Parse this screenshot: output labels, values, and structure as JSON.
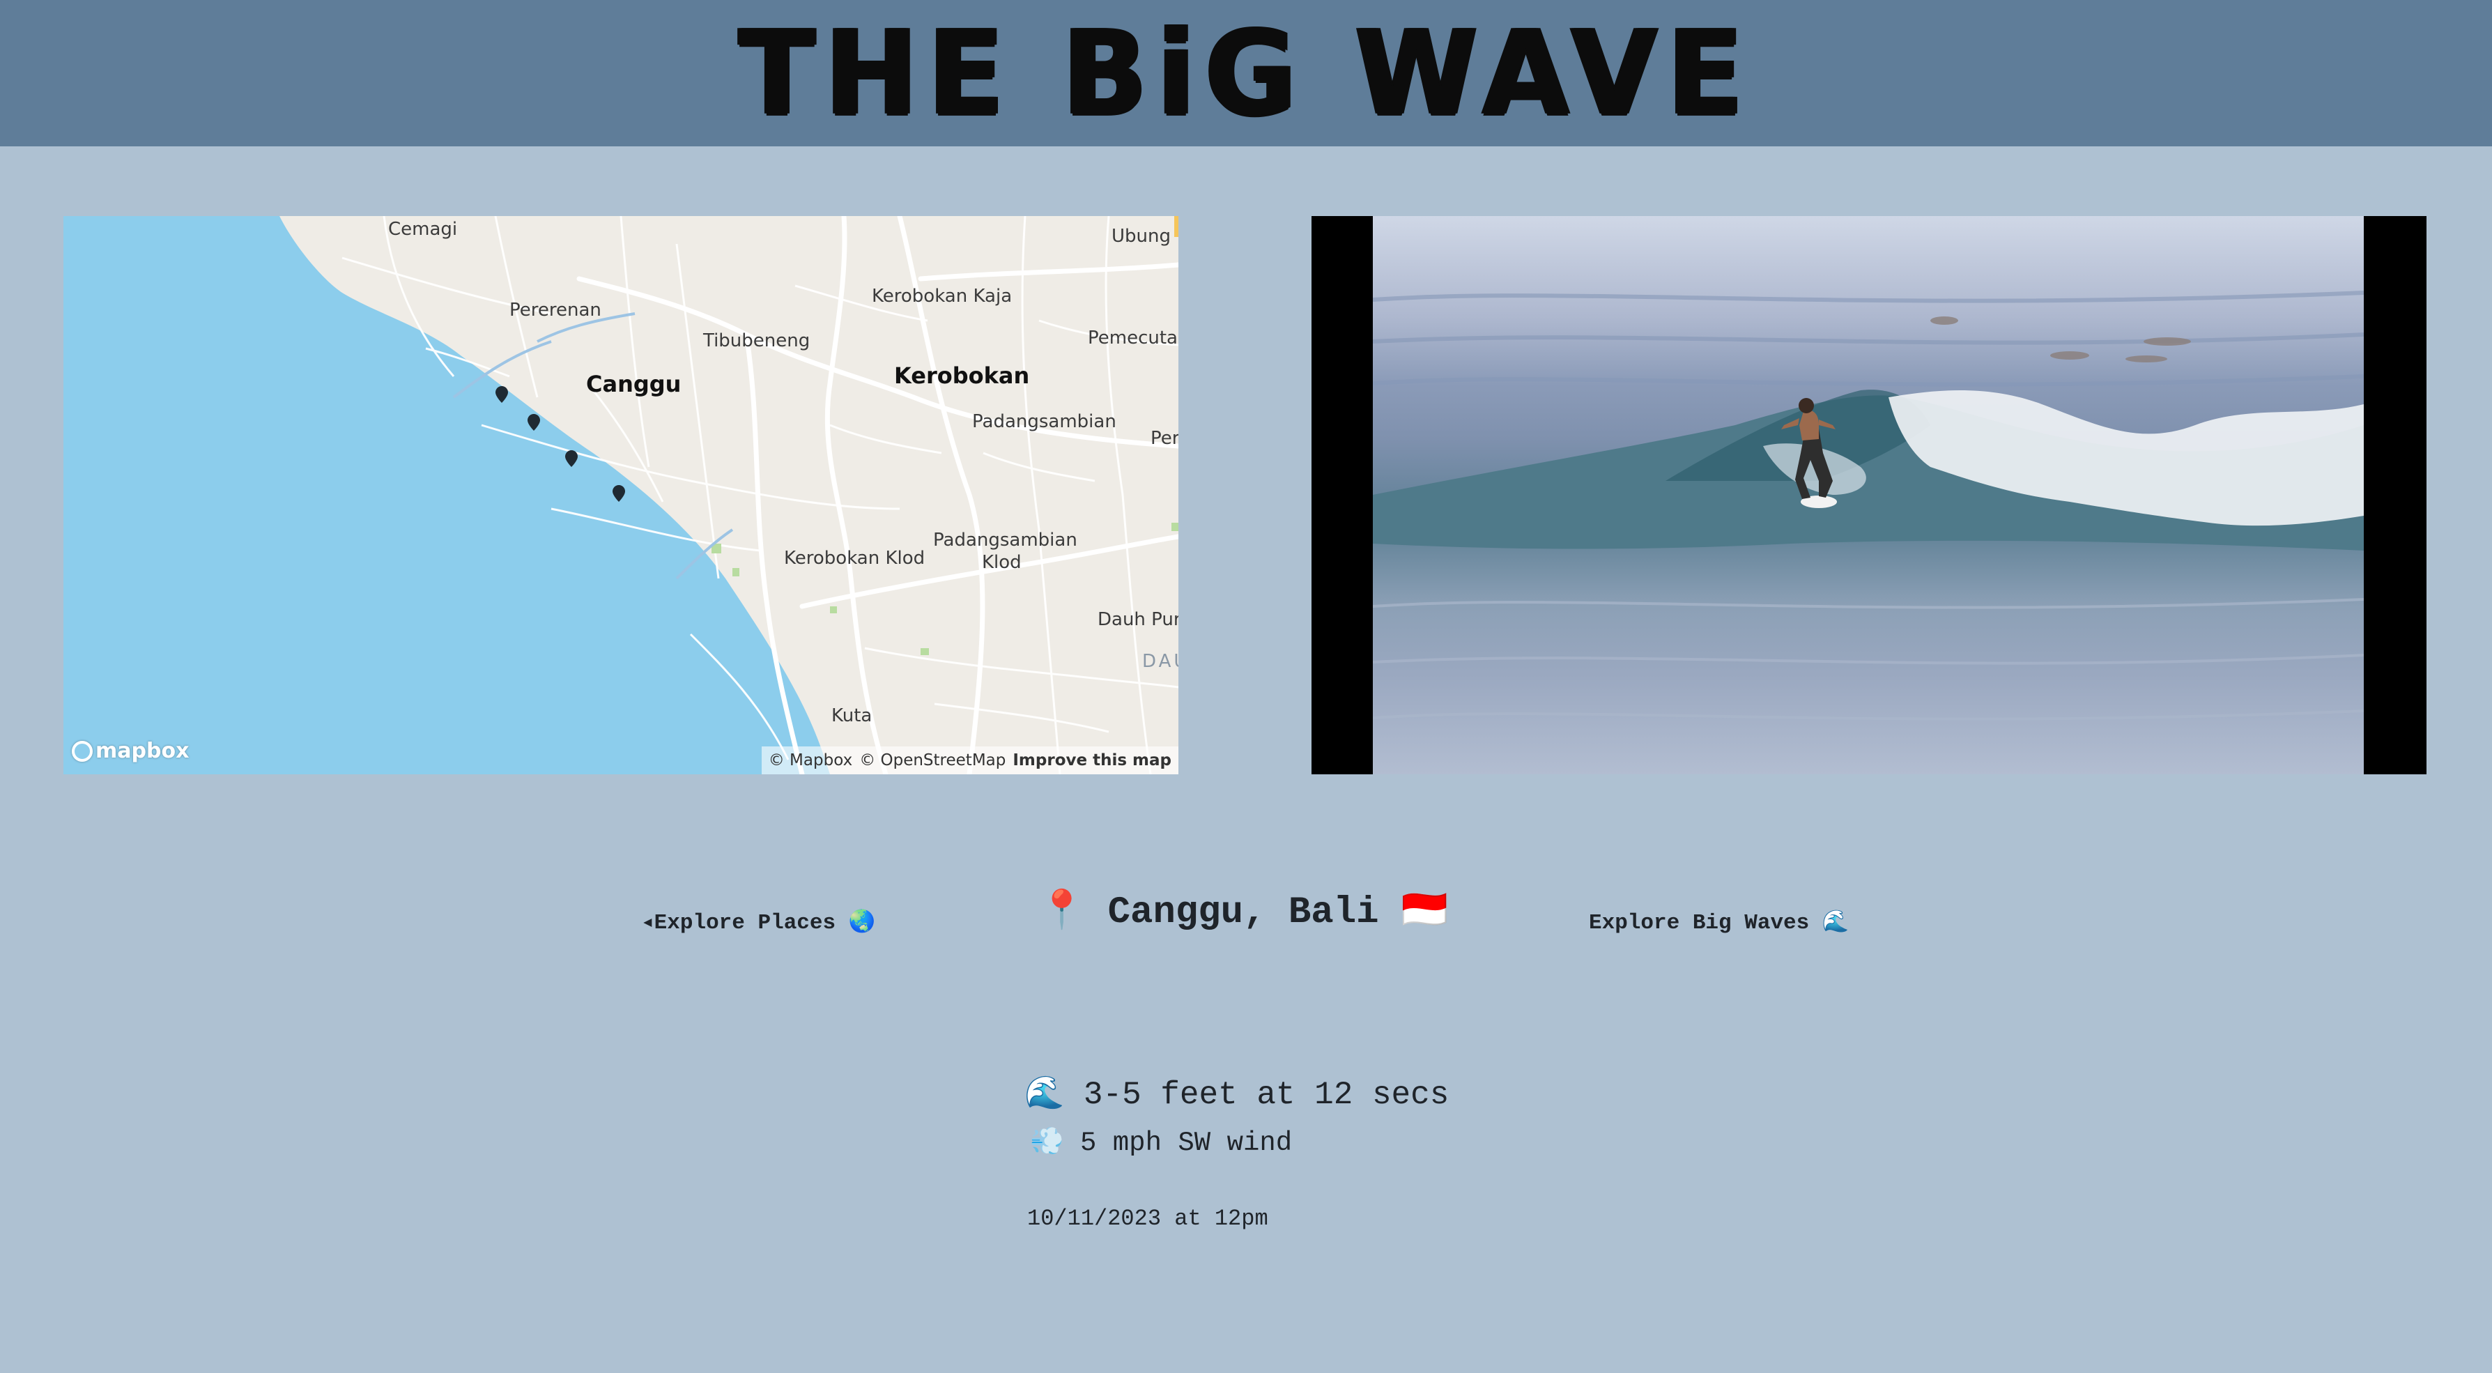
{
  "header": {
    "title": "THE BiG WAVE"
  },
  "map": {
    "labels": {
      "cemagi": "Cemagi",
      "ubung": "Ubung",
      "pererenan": "Pererenan",
      "kerobokan_kaja": "Kerobokan Kaja",
      "tibubeneng": "Tibubeneng",
      "pemecutan": "Pemecutar",
      "canggu": "Canggu",
      "kerobokan": "Kerobokan",
      "padangsambian": "Padangsambian",
      "per": "Per",
      "kerobokan_klod": "Kerobokan Klod",
      "padangsambian_klod_1": "Padangsambian",
      "padangsambian_klod_2": "Klod",
      "dauh_puri": "Dauh Puri",
      "dau": "DAU",
      "kuta": "Kuta"
    },
    "logo_text": "mapbox",
    "attribution": {
      "mapbox": "© Mapbox",
      "osm": "© OpenStreetMap",
      "improve": "Improve this map"
    },
    "colors": {
      "water": "#8ccdec",
      "land": "#efece6",
      "roads": "#ffffff",
      "pin": "#1f2a33"
    }
  },
  "video": {
    "description_icon": "surfer-video"
  },
  "nav": {
    "prev_label": "◂Explore Places 🌏",
    "next_label": "Explore Big Waves 🌊"
  },
  "location": {
    "label": "📍 Canggu, Bali 🇮🇩"
  },
  "conditions": {
    "swell": "🌊 3-5 feet at 12 secs",
    "wind": "💨 5 mph SW wind",
    "timestamp": "10/11/2023 at 12pm"
  }
}
